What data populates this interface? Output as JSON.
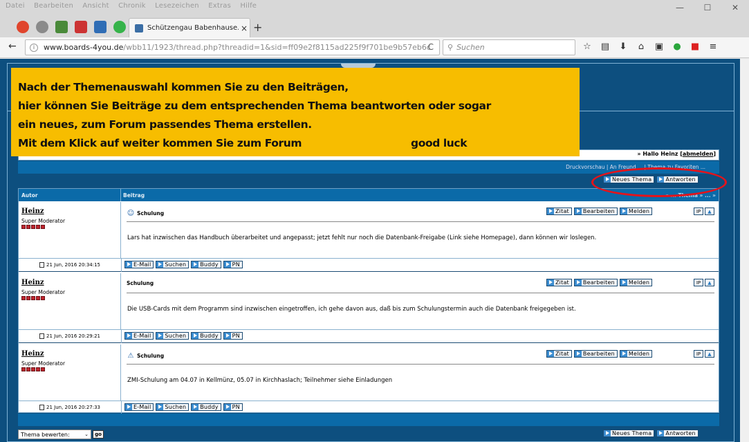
{
  "menubar": [
    "Datei",
    "Bearbeiten",
    "Ansicht",
    "Chronik",
    "Lesezeichen",
    "Extras",
    "Hilfe"
  ],
  "window": {
    "minimize": "—",
    "maximize": "☐",
    "close": "✕"
  },
  "tab": {
    "title": "Schützengau Babenhause...",
    "close": "×",
    "new": "+"
  },
  "nav": {
    "back": "←",
    "url_host": "www.boards-4you.de",
    "url_path": "/wbb11/1923/thread.php?threadid=1&sid=ff09e2f8115ad225f9f701be9b57eb6c",
    "reload": "C",
    "search_placeholder": "Suchen"
  },
  "userbar": {
    "greeting": "» Hallo Heinz [",
    "logout": "abmelden",
    "close_bracket": "]"
  },
  "optbar": {
    "text": "Druckvorschau | An Freund ... | Thema zu Favoriten ..."
  },
  "buttons": {
    "new_topic": "Neues Thema",
    "reply": "Antworten",
    "quote": "Zitat",
    "edit": "Bearbeiten",
    "report": "Melden",
    "ip": "IP",
    "email": "E-Mail",
    "search": "Suchen",
    "buddy": "Buddy",
    "pm": "PN"
  },
  "table": {
    "col_author": "Autor",
    "col_post": "Beitrag",
    "pager": "« ... Thema » ... »"
  },
  "posts": [
    {
      "author": "Heinz",
      "rank": "Super Moderator",
      "subject": "Schulung",
      "icon": "smiley-icon",
      "message": "Lars hat inzwischen das Handbuch überarbeitet und angepasst; jetzt fehlt nur noch die Datenbank-Freigabe (Link siehe Homepage), dann können wir loslegen.",
      "date": "21 Jun, 2016 20:34:15"
    },
    {
      "author": "Heinz",
      "rank": "Super Moderator",
      "subject": "Schulung",
      "icon": "",
      "message": "Die USB-Cards mit dem Programm sind inzwischen eingetroffen, ich gehe davon aus, daß bis zum Schulungstermin auch die Datenbank freigegeben ist.",
      "date": "21 Jun, 2016 20:29:21"
    },
    {
      "author": "Heinz",
      "rank": "Super Moderator",
      "subject": "Schulung",
      "icon": "warning-icon",
      "message": "ZMI-Schulung am 04.07 in Kellmünz, 05.07 in Kirchhaslach; Teilnehmer siehe Einladungen",
      "date": "21 Jun, 2016 20:27:33"
    }
  ],
  "rating": {
    "label": "Thema bewerten:",
    "go": "go"
  },
  "note": {
    "line1": "Nach der Themenauswahl kommen Sie zu den Beiträgen,",
    "line2": "hier können Sie Beiträge zu dem entsprechenden Thema beantworten oder sogar",
    "line3": "ein neues, zum Forum passendes Thema erstellen.",
    "line4": "Mit dem Klick auf weiter kommen Sie zum Forum",
    "good_luck": "good luck"
  },
  "colors": {
    "accent_blue": "#0d4f7f",
    "header_blue": "#0b6aa8",
    "note_yellow": "#f7bd00",
    "circle_red": "#e5131a"
  }
}
